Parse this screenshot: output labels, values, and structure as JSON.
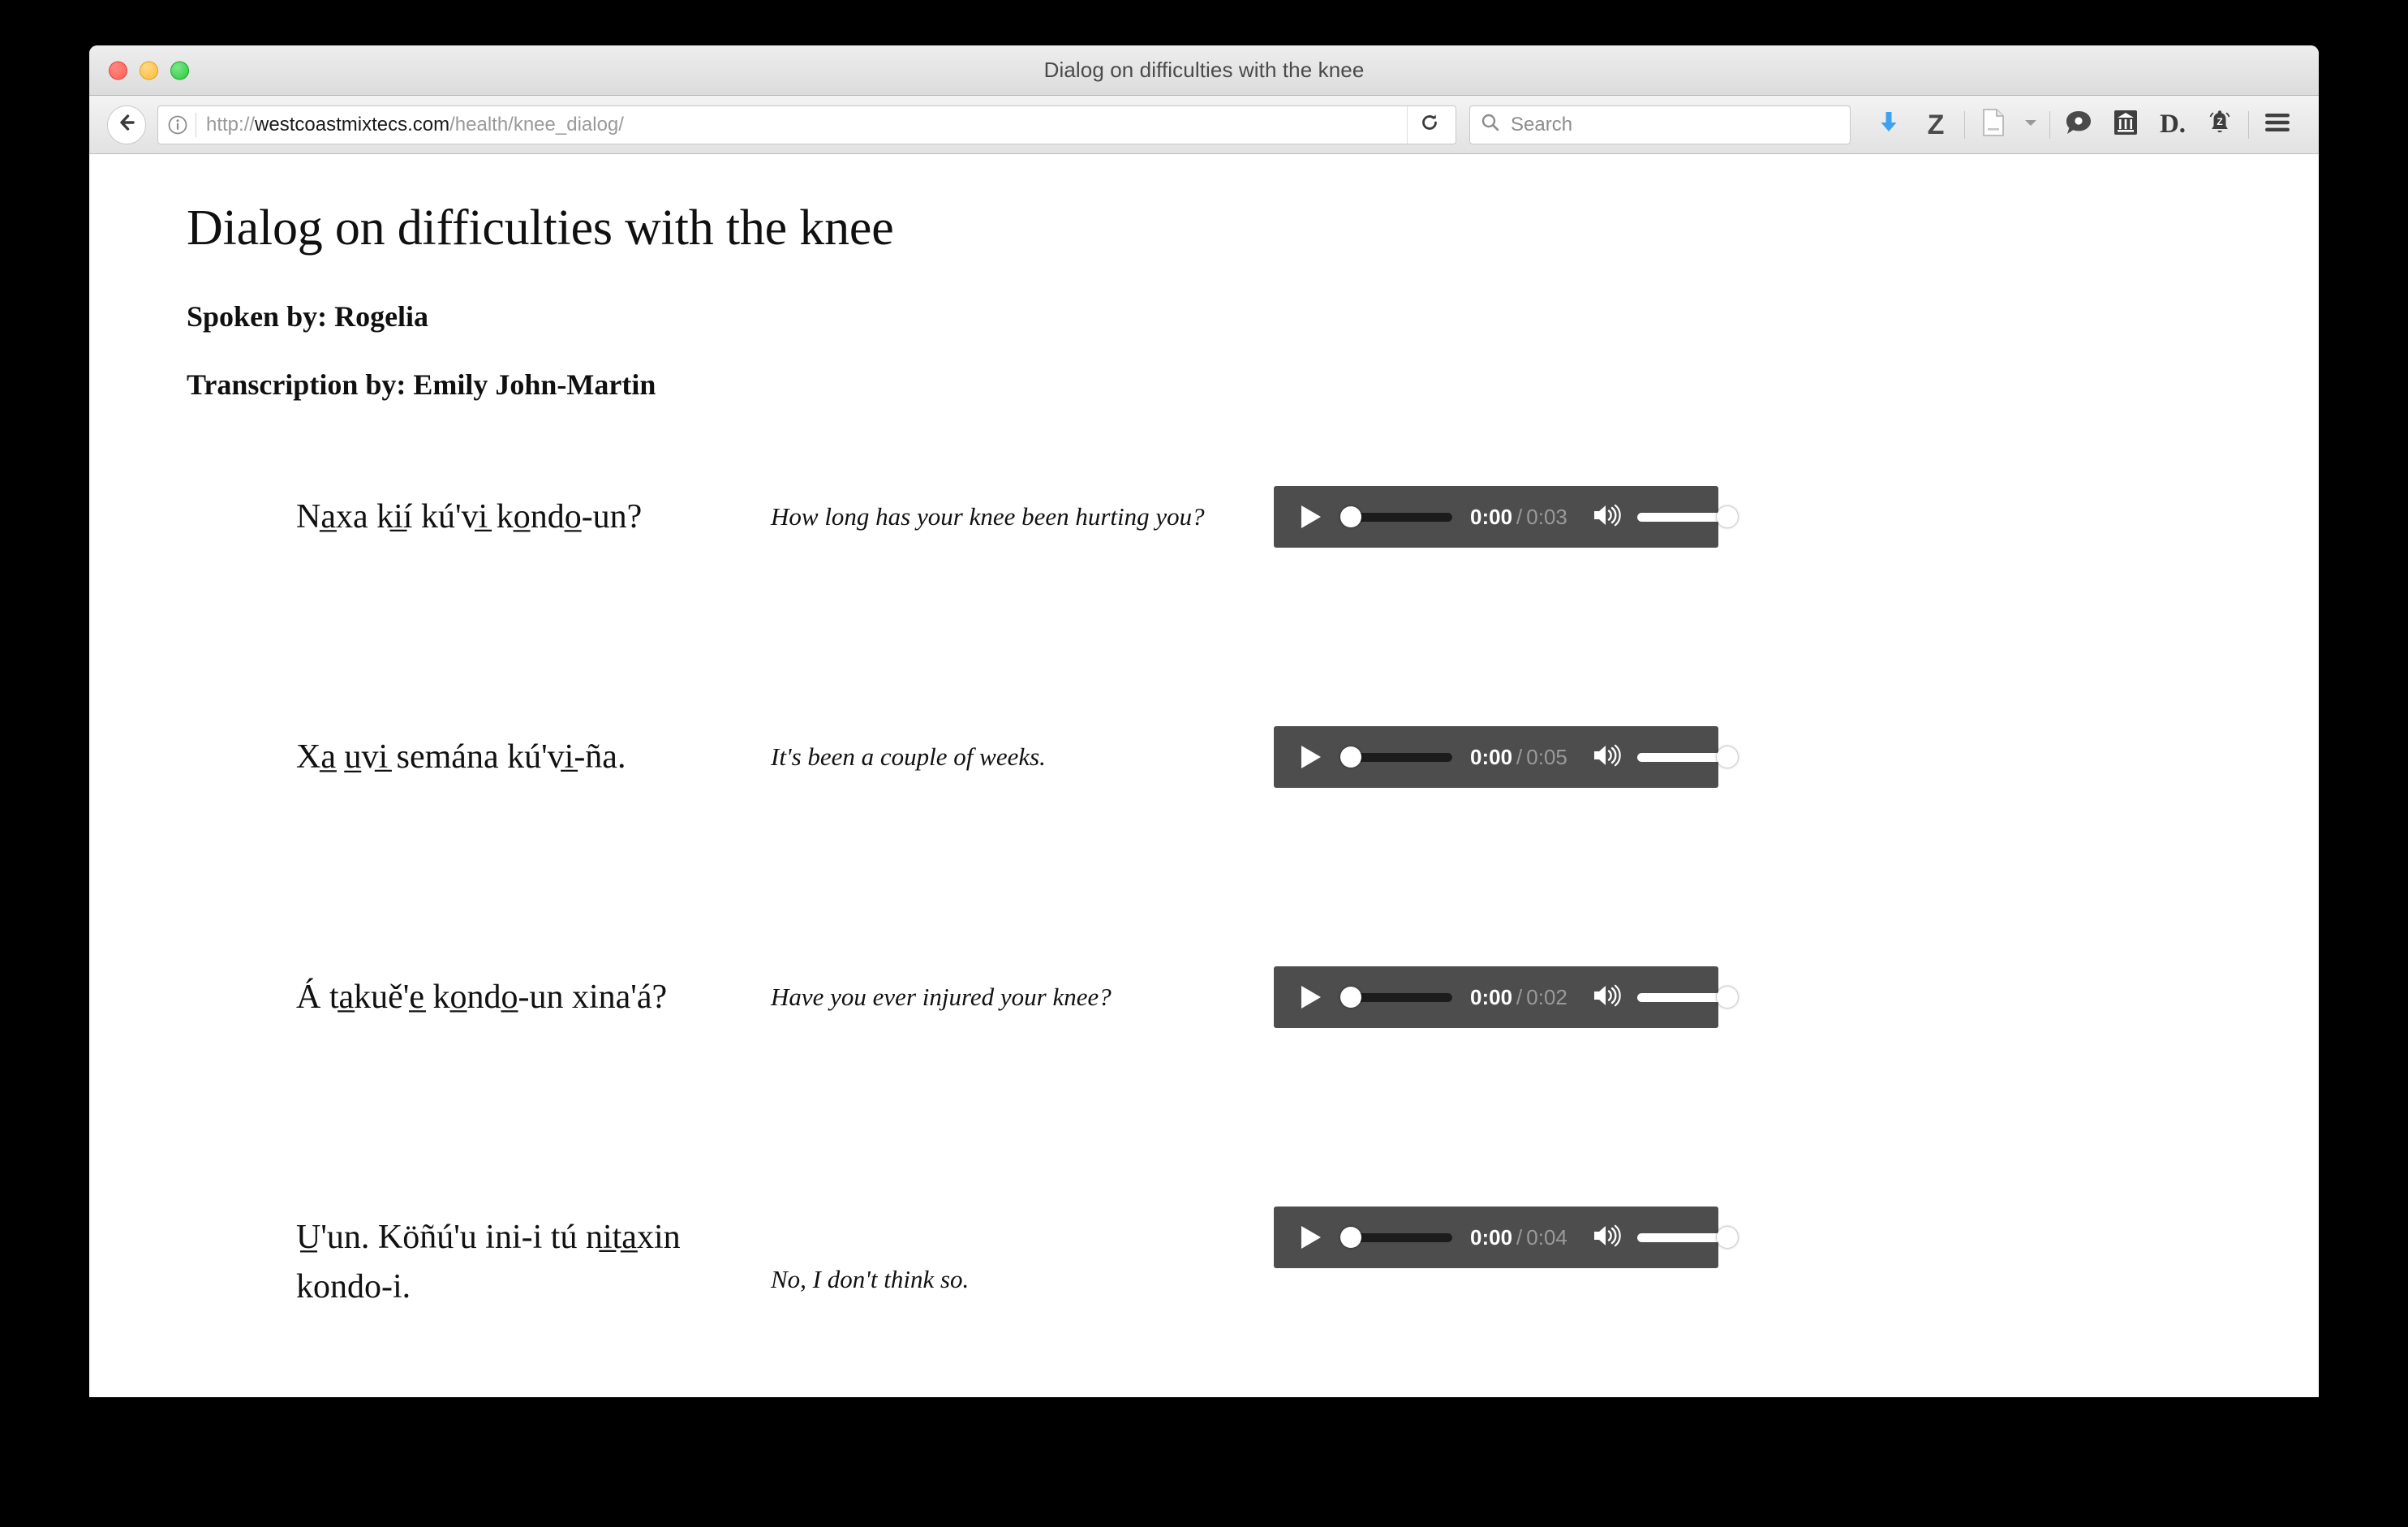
{
  "window": {
    "title": "Dialog on difficulties with the knee",
    "traffic_lights": [
      "close",
      "minimize",
      "zoom"
    ]
  },
  "browser": {
    "back_icon": "back-arrow-icon",
    "info_icon": "info-icon",
    "url_scheme": "http://",
    "url_host": "westcoastmixtecs.com",
    "url_path": "/health/knee_dialog/",
    "reload_icon": "reload-icon",
    "search": {
      "icon": "search-icon",
      "placeholder": "Search",
      "value": ""
    },
    "toolbar_icons": [
      {
        "name": "downloads-icon",
        "label": "",
        "color": "#3da2f0"
      },
      {
        "name": "zotero-icon",
        "label": "Z"
      },
      {
        "name": "document-icon",
        "label": ""
      },
      {
        "name": "chevron-down-icon",
        "label": ""
      },
      {
        "name": "speech-bubble-icon",
        "label": ""
      },
      {
        "name": "library-icon",
        "label": ""
      },
      {
        "name": "dictionary-icon",
        "label": "D."
      },
      {
        "name": "bell-alert-icon",
        "label": ""
      },
      {
        "name": "hamburger-menu-icon",
        "label": ""
      }
    ]
  },
  "page": {
    "title": "Dialog on difficulties with the knee",
    "spoken_by": "Spoken by: Rogelia",
    "transcription_by": "Transcription by: Emily John-Martin",
    "rows": [
      {
        "native": "Na̲xa ki̲í kú'vi̲ ko̲ndo̲-un?",
        "english": "How long has your knee been hurting you?",
        "audio": {
          "current_time": "0:00",
          "separator": "/",
          "duration": "0:03",
          "play_icon": "play-icon",
          "volume_icon": "volume-icon",
          "progress_percent": 0,
          "volume_percent": 100
        }
      },
      {
        "native": "Xa̲ u̲vi̲ semána kú'vi̲-ña.",
        "english": "It's been a couple of weeks.",
        "audio": {
          "current_time": "0:00",
          "separator": "/",
          "duration": "0:05",
          "play_icon": "play-icon",
          "volume_icon": "volume-icon",
          "progress_percent": 0,
          "volume_percent": 100
        }
      },
      {
        "native": "Á ta̲kuě'e̲ ko̲ndo̲-un xina'á?",
        "english": "Have you ever injured your knee?",
        "audio": {
          "current_time": "0:00",
          "separator": "/",
          "duration": "0:02",
          "play_icon": "play-icon",
          "volume_icon": "volume-icon",
          "progress_percent": 0,
          "volume_percent": 100
        }
      },
      {
        "native": "U̲'un. Köñú'u ini-i tú ni̲ta̲xin kondo-i.",
        "english": "No, I don't think so.",
        "audio": {
          "current_time": "0:00",
          "separator": "/",
          "duration": "0:04",
          "play_icon": "play-icon",
          "volume_icon": "volume-icon",
          "progress_percent": 0,
          "volume_percent": 100
        }
      }
    ]
  }
}
